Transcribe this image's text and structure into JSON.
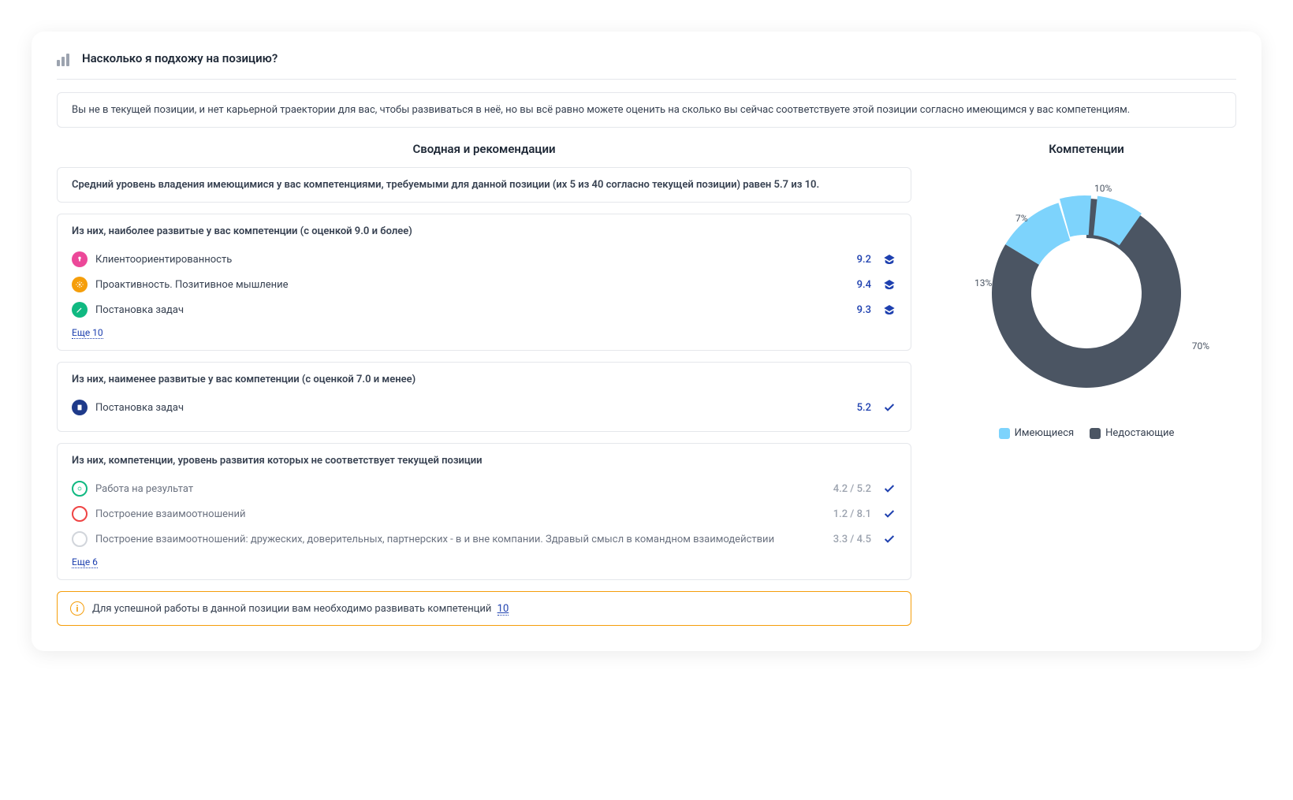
{
  "header": {
    "title": "Насколько я подхожу на позицию?"
  },
  "banner": "Вы не в текущей позиции, и нет карьерной траектории для вас, чтобы развиваться в неё, но вы всё равно можете оценить на сколько вы сейчас соответствуете этой позиции согласно имеющимся у вас компетенциям.",
  "summary": {
    "title": "Сводная и рекомендации",
    "avg_text": "Средний уровень владения имеющимися у вас компетенциями, требуемыми для данной позиции (их 5 из 40 согласно текущей позиции) равен 5.7 из 10."
  },
  "high": {
    "header": "Из них, наиболее развитые у вас компетенции (с оценкой 9.0 и более)",
    "items": [
      {
        "name": "Клиентоориентированность",
        "score": "9.2",
        "icon": "pink"
      },
      {
        "name": "Проактивность. Позитивное мышление",
        "score": "9.4",
        "icon": "orange"
      },
      {
        "name": "Постановка задач",
        "score": "9.3",
        "icon": "green"
      }
    ],
    "more_label": "Еще 10"
  },
  "low": {
    "header": "Из них, наименее развитые у вас компетенции (с оценкой 7.0 и менее)",
    "items": [
      {
        "name": "Постановка задач",
        "score": "5.2",
        "icon": "navy"
      }
    ]
  },
  "mismatch": {
    "header": "Из них, компетенции, уровень развития которых не соответствует текущей позиции",
    "items": [
      {
        "name": "Работа на результат",
        "score": "4.2 / 5.2",
        "icon": "outline-green"
      },
      {
        "name": "Построение взаимоотношений",
        "score": "1.2 / 8.1",
        "icon": "outline-red"
      },
      {
        "name": "Построение взаимоотношений: дружеских, доверительных, партнерских - в и вне компании. Здравый смысл в командном взаимодействии",
        "score": "3.3 / 4.5",
        "icon": "outline-gray"
      }
    ],
    "more_label": "Еще 6"
  },
  "alert": {
    "text": "Для успешной работы в данной позиции вам необходимо развивать компетенций",
    "count": "10"
  },
  "chart": {
    "title": "Компетенции",
    "legend": {
      "have": "Имеющиеся",
      "missing": "Недостающие"
    }
  },
  "chart_data": {
    "type": "pie",
    "title": "Компетенции",
    "series": [
      {
        "name": "Имеющиеся",
        "values": [
          13,
          7,
          10
        ],
        "color": "#7dd3fc"
      },
      {
        "name": "Недостающие",
        "values": [
          70
        ],
        "color": "#4b5563"
      }
    ],
    "labels": [
      "13%",
      "7%",
      "10%",
      "70%"
    ],
    "donut": true
  }
}
